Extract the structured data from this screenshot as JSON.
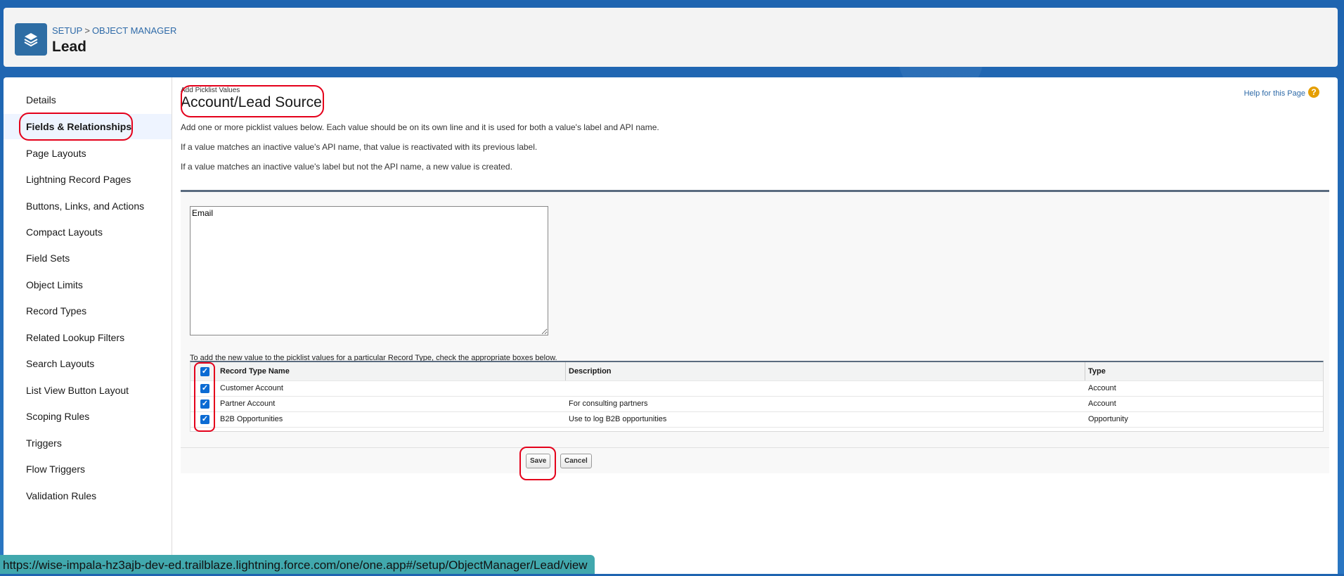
{
  "header": {
    "breadcrumb": [
      "SETUP",
      "OBJECT MANAGER"
    ],
    "breadcrumb_sep": ">",
    "title": "Lead",
    "icon": "layers-icon"
  },
  "sidebar": {
    "items": [
      {
        "label": "Details"
      },
      {
        "label": "Fields & Relationships",
        "active": true
      },
      {
        "label": "Page Layouts"
      },
      {
        "label": "Lightning Record Pages"
      },
      {
        "label": "Buttons, Links, and Actions"
      },
      {
        "label": "Compact Layouts"
      },
      {
        "label": "Field Sets"
      },
      {
        "label": "Object Limits"
      },
      {
        "label": "Record Types"
      },
      {
        "label": "Related Lookup Filters"
      },
      {
        "label": "Search Layouts"
      },
      {
        "label": "List View Button Layout"
      },
      {
        "label": "Scoping Rules"
      },
      {
        "label": "Triggers"
      },
      {
        "label": "Flow Triggers"
      },
      {
        "label": "Validation Rules"
      }
    ]
  },
  "main": {
    "subtitle": "Add Picklist Values",
    "title": "Account/Lead Source",
    "help_link": "Help for this Page",
    "help_icon": "?",
    "descriptions": [
      "Add one or more picklist values below. Each value should be on its own line and it is used for both a value's label and API name.",
      "If a value matches an inactive value's API name, that value is reactivated with its previous label.",
      "If a value matches an inactive value's label but not the API name, a new value is created."
    ],
    "values_text": "Email",
    "record_type_caption": "To add the new value to the picklist values for a particular Record Type, check the appropriate boxes below.",
    "table": {
      "headers": [
        "Record Type Name",
        "Description",
        "Type"
      ],
      "header_checked": true,
      "rows": [
        {
          "name": "Customer Account",
          "description": "",
          "type": "Account",
          "checked": true
        },
        {
          "name": "Partner Account",
          "description": "For consulting partners",
          "type": "Account",
          "checked": true
        },
        {
          "name": "B2B Opportunities",
          "description": "Use to log B2B opportunities",
          "type": "Opportunity",
          "checked": true
        }
      ]
    },
    "save_label": "Save",
    "cancel_label": "Cancel"
  },
  "status_bar": {
    "url": "https://wise-impala-hz3ajb-dev-ed.trailblaze.lightning.force.com/one/one.app#/setup/ObjectManager/Lead/view"
  },
  "colors": {
    "accent": "#0b6bd3",
    "highlight": "#e4001b",
    "header_bg": "#1b5fa8"
  }
}
